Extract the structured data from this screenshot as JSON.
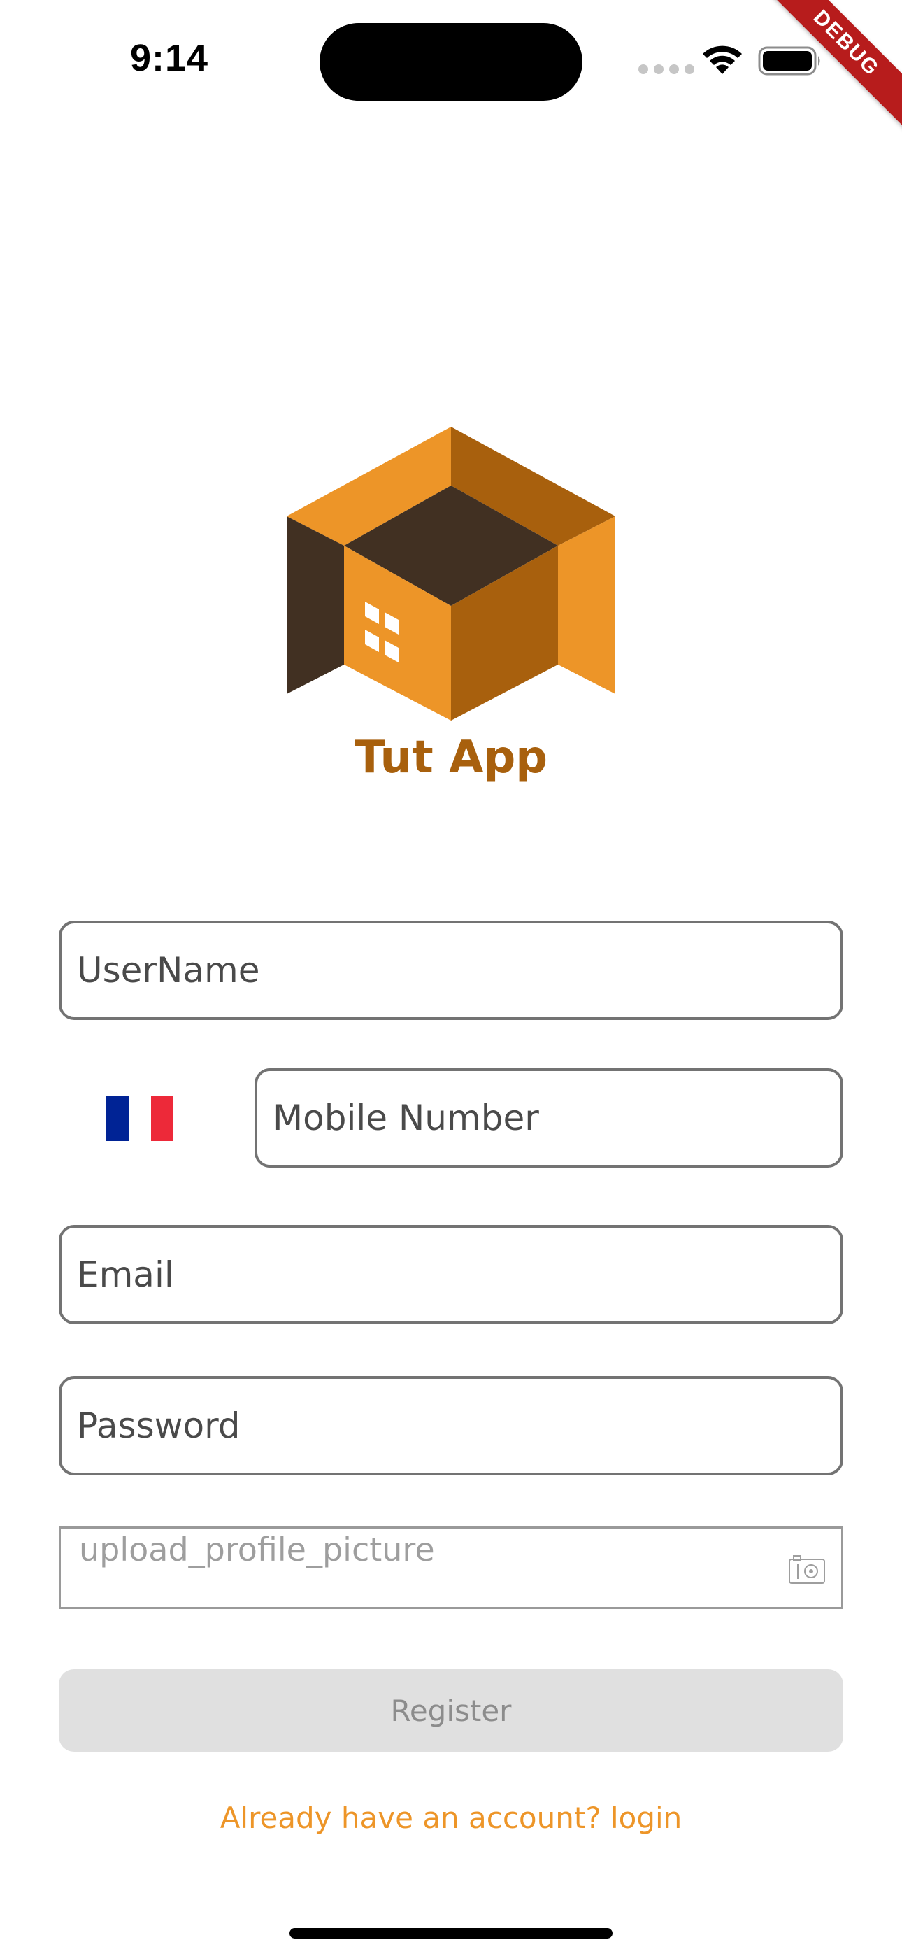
{
  "status_bar": {
    "time": "9:14",
    "icons": [
      "cellular-icon",
      "wifi-icon",
      "battery-icon"
    ]
  },
  "debug_banner": "DEBUG",
  "app": {
    "name": "Tut App",
    "logo_icon": "cube-house-logo",
    "colors": {
      "brand_orange": "#ED9528",
      "brand_dark_orange": "#A8600D",
      "brand_brown": "#413022"
    }
  },
  "form": {
    "username_placeholder": "UserName",
    "country_flag": "France",
    "mobile_placeholder": "Mobile Number",
    "email_placeholder": "Email",
    "password_placeholder": "Password",
    "upload_profile_label": "upload_profile_picture",
    "register_label": "Register",
    "login_link": "Already have an account? login"
  }
}
